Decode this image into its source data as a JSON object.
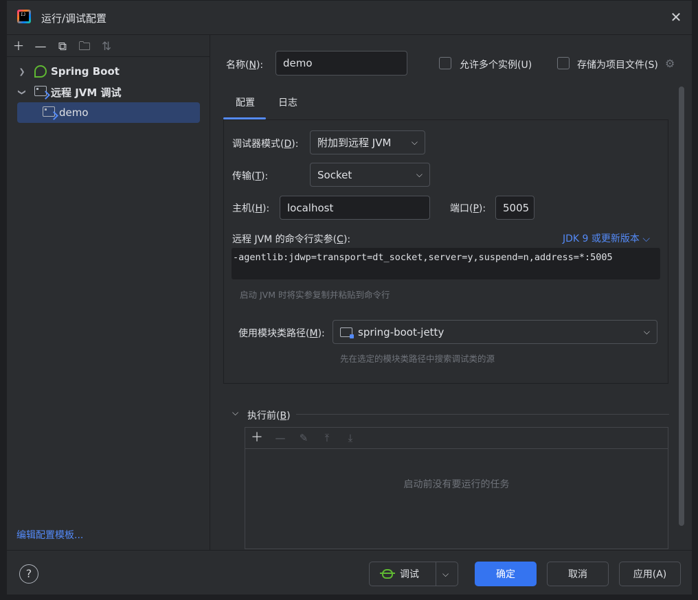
{
  "window": {
    "title": "运行/调试配置",
    "close_icon": "close-icon"
  },
  "left_toolbar": {
    "icons": [
      "add-icon",
      "remove-icon",
      "copy-icon",
      "new-folder-icon",
      "sort-icon"
    ]
  },
  "tree": {
    "items": [
      {
        "label": "Spring Boot",
        "icon": "spring-boot-icon",
        "expanded": false
      },
      {
        "label": "远程 JVM 调试",
        "icon": "remote-jvm-icon",
        "expanded": true
      },
      {
        "label": "demo",
        "icon": "remote-jvm-icon",
        "selected": true
      }
    ]
  },
  "edit_templates_link": "编辑配置模板...",
  "form": {
    "name_label": "名称(",
    "name_mnemonic": "N",
    "name_label_end": "):",
    "name_value": "demo",
    "allow_multiple_label": "允许多个实例(U)",
    "store_as_file_label": "存储为项目文件(S)",
    "tabs": [
      "配置",
      "日志"
    ],
    "debugger_mode_label": "调试器模式(",
    "debugger_mode_mnemonic": "D",
    "debugger_mode_end": "):",
    "debugger_mode_value": "附加到远程 JVM",
    "transport_label": "传输(",
    "transport_mnemonic": "T",
    "transport_end": "):",
    "transport_value": "Socket",
    "host_label": "主机(",
    "host_mnemonic": "H",
    "host_end": "):",
    "host_value": "localhost",
    "port_label": "端口(",
    "port_mnemonic": "P",
    "port_end": "):",
    "port_value": "5005",
    "cmdline_label": "远程 JVM 的命令行实参(",
    "cmdline_mnemonic": "C",
    "cmdline_end": "):",
    "jdk_link": "JDK 9 或更新版本",
    "cmdline_value": "-agentlib:jdwp=transport=dt_socket,server=y,suspend=n,address=*:5005",
    "cmdline_hint": "启动 JVM 时将实参复制并粘贴到命令行",
    "module_label": "使用模块类路径(",
    "module_mnemonic": "M",
    "module_end": "):",
    "module_value": "spring-boot-jetty",
    "module_hint": "先在选定的模块类路径中搜索调试类的源",
    "before_launch_label": "执行前(",
    "before_launch_mnemonic": "B",
    "before_launch_end": ")",
    "before_launch_empty": "启动前没有要运行的任务"
  },
  "footer": {
    "help": "?",
    "debug_label": "调试",
    "ok_label": "确定",
    "cancel_label": "取消",
    "apply_label": "应用(A)"
  },
  "colors": {
    "accent": "#3574f0",
    "link": "#548af7",
    "selection": "#2e436e",
    "background": "#2b2d30"
  }
}
